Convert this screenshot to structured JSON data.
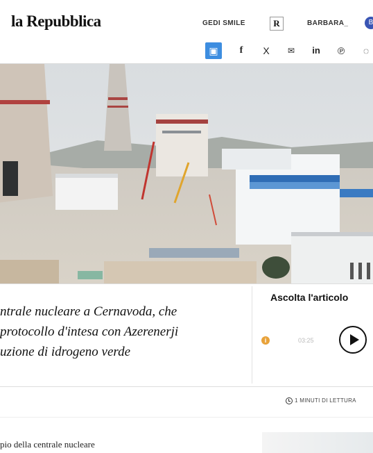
{
  "header": {
    "logo": "la Repubblica",
    "nav": {
      "gedi_smile": "GEDI SMILE",
      "rep_badge": "R",
      "user_name": "BARBARA_",
      "user_initial": "B"
    }
  },
  "share": {
    "items": [
      {
        "name": "comment-icon",
        "glyph": "▣"
      },
      {
        "name": "facebook-icon",
        "glyph": "f"
      },
      {
        "name": "x-icon",
        "glyph": "X"
      },
      {
        "name": "email-icon",
        "glyph": "✉"
      },
      {
        "name": "linkedin-icon",
        "glyph": "in"
      },
      {
        "name": "pinterest-icon",
        "glyph": "℗"
      },
      {
        "name": "whatsapp-icon",
        "glyph": "◌"
      }
    ]
  },
  "article": {
    "title_lines": [
      "ntrale nucleare a Cernavoda, che",
      "protocollo d'intesa con Azerenerji",
      "uzione di idrogeno verde"
    ],
    "read_time": "1 MINUTI DI LETTURA",
    "caption": "pio della centrale nucleare"
  },
  "audio": {
    "label": "Ascolta l'articolo",
    "duration": "03:25"
  },
  "colors": {
    "accent": "#3d8de0",
    "info": "#e8a23a",
    "user": "#3a55b4"
  }
}
